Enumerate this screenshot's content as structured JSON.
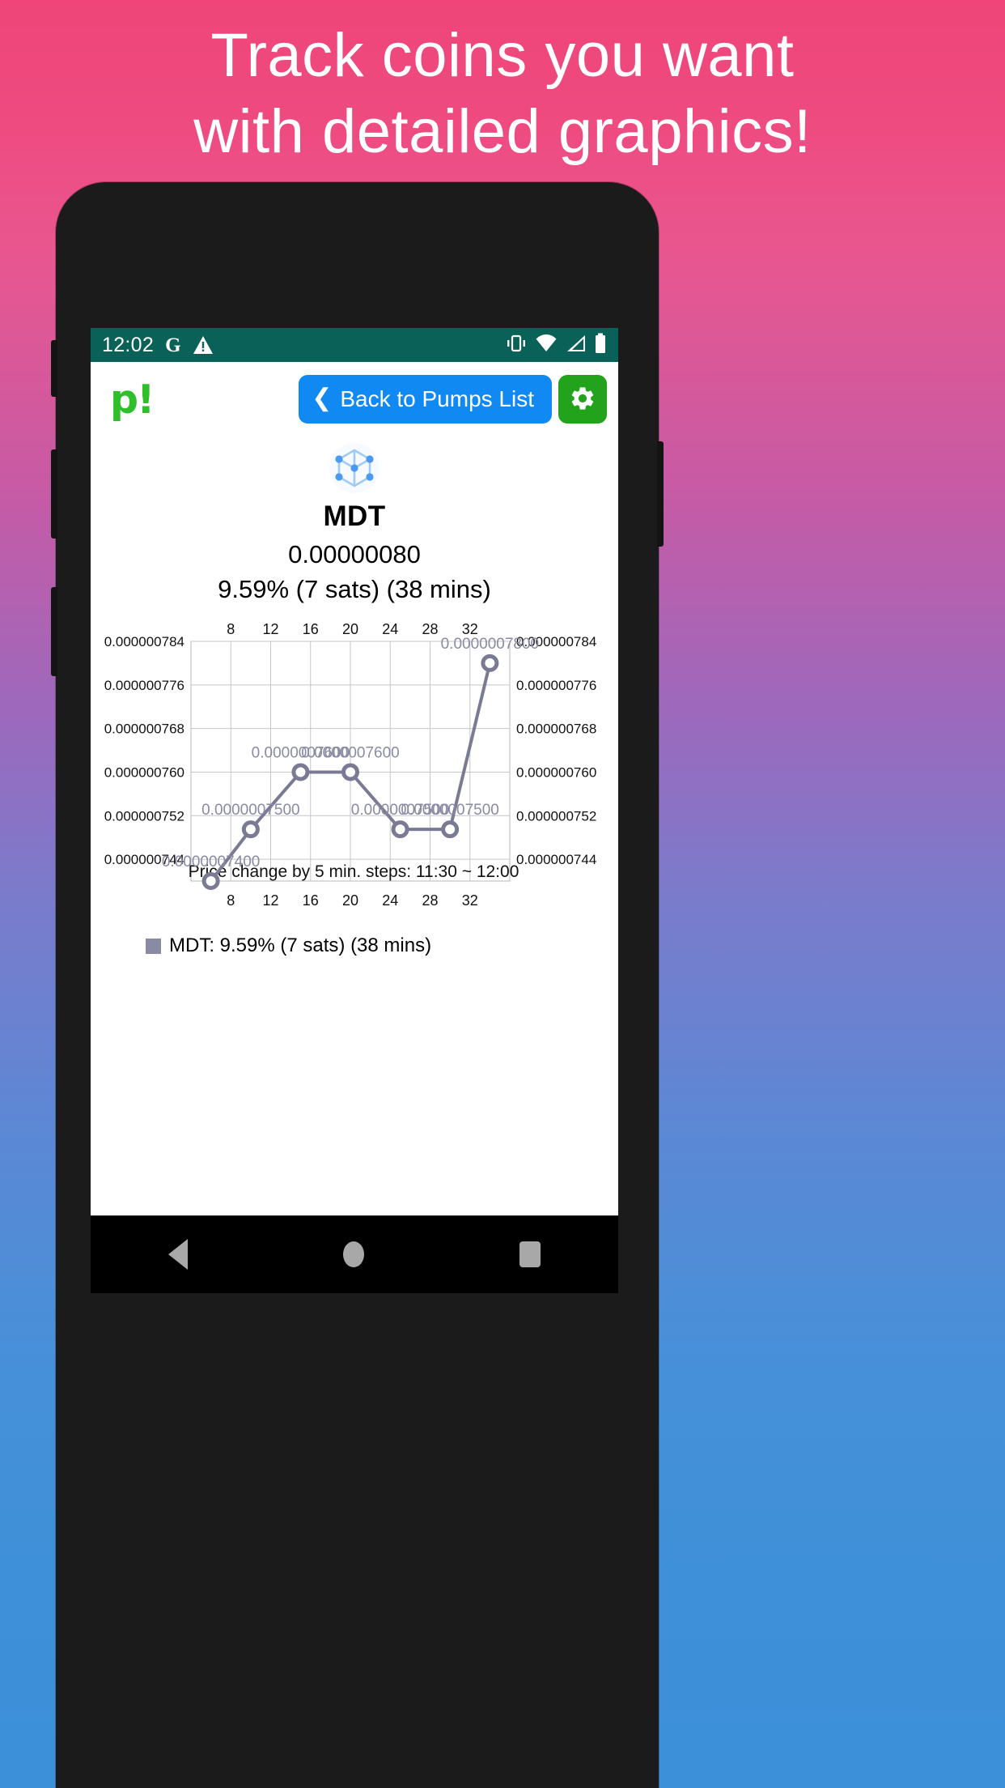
{
  "promo": {
    "line1": "Track coins you want",
    "line2": "with detailed graphics!",
    "bg_top_color": "#ef4579",
    "bg_bottom_color": "#3c90d9"
  },
  "statusbar": {
    "time": "12:02",
    "google_icon": "G",
    "warning_icon": "warning-triangle",
    "vibrate_icon": "vibrate",
    "wifi_icon": "wifi",
    "signal_icon": "signal",
    "battery_icon": "battery-full",
    "bg_color": "#0a6157"
  },
  "header": {
    "logo_text": "p!",
    "logo_color": "#2fbf2a",
    "back_label": "Back to Pumps List",
    "back_color": "#1089f2",
    "settings_label": "Settings",
    "settings_color": "#23a31c"
  },
  "coin": {
    "icon_name": "mdt-cube-icon",
    "symbol": "MDT",
    "price": "0.00000080",
    "change": "9.59% (7 sats) (38 mins)"
  },
  "legend": {
    "swatch_color": "#8a8aa3",
    "label": "MDT: 9.59% (7 sats) (38 mins)"
  },
  "navbar": {
    "back": "back",
    "home": "home",
    "recents": "recents"
  },
  "chart_data": {
    "type": "line",
    "title": "",
    "xlabel": "Price change by 5 min. steps: 11:30 ~ 12:00",
    "ylabel": "",
    "series": [
      {
        "name": "MDT: 9.59% (7 sats) (38 mins)",
        "color": "#7a7a95",
        "x": [
          6,
          10,
          15,
          20,
          25,
          30,
          34
        ],
        "values": [
          7.4e-07,
          7.495e-07,
          7.6e-07,
          7.6e-07,
          7.495e-07,
          7.495e-07,
          7.8e-07
        ],
        "point_labels": [
          "0.0000007400",
          "0.0000007500",
          "0.0000007600",
          "0.0000007600",
          "0.0000007500",
          "0.0000007500",
          "0.0000007800"
        ]
      }
    ],
    "ylim": [
      7.4e-07,
      7.84e-07
    ],
    "yticks": [
      7.44e-07,
      7.52e-07,
      7.6e-07,
      7.68e-07,
      7.76e-07,
      7.84e-07
    ],
    "ytick_labels": [
      "0.000000744",
      "0.000000752",
      "0.000000760",
      "0.000000768",
      "0.000000776",
      "0.000000784"
    ],
    "ytick_labels_right": [
      "0.000000744",
      "0.000000752",
      "0.000000760",
      "0.000000768",
      "0.000000776",
      "0.000000784"
    ],
    "xlim": [
      4,
      36
    ],
    "xticks": [
      8,
      12,
      16,
      20,
      24,
      28,
      32
    ],
    "xtick_labels": [
      "8",
      "12",
      "16",
      "20",
      "24",
      "28",
      "32"
    ],
    "xtick_labels_top": [
      "8",
      "12",
      "16",
      "20",
      "24",
      "28",
      "32"
    ],
    "grid": true,
    "legend_position": "bottom-left",
    "axis_top": true,
    "axis_right": true
  }
}
